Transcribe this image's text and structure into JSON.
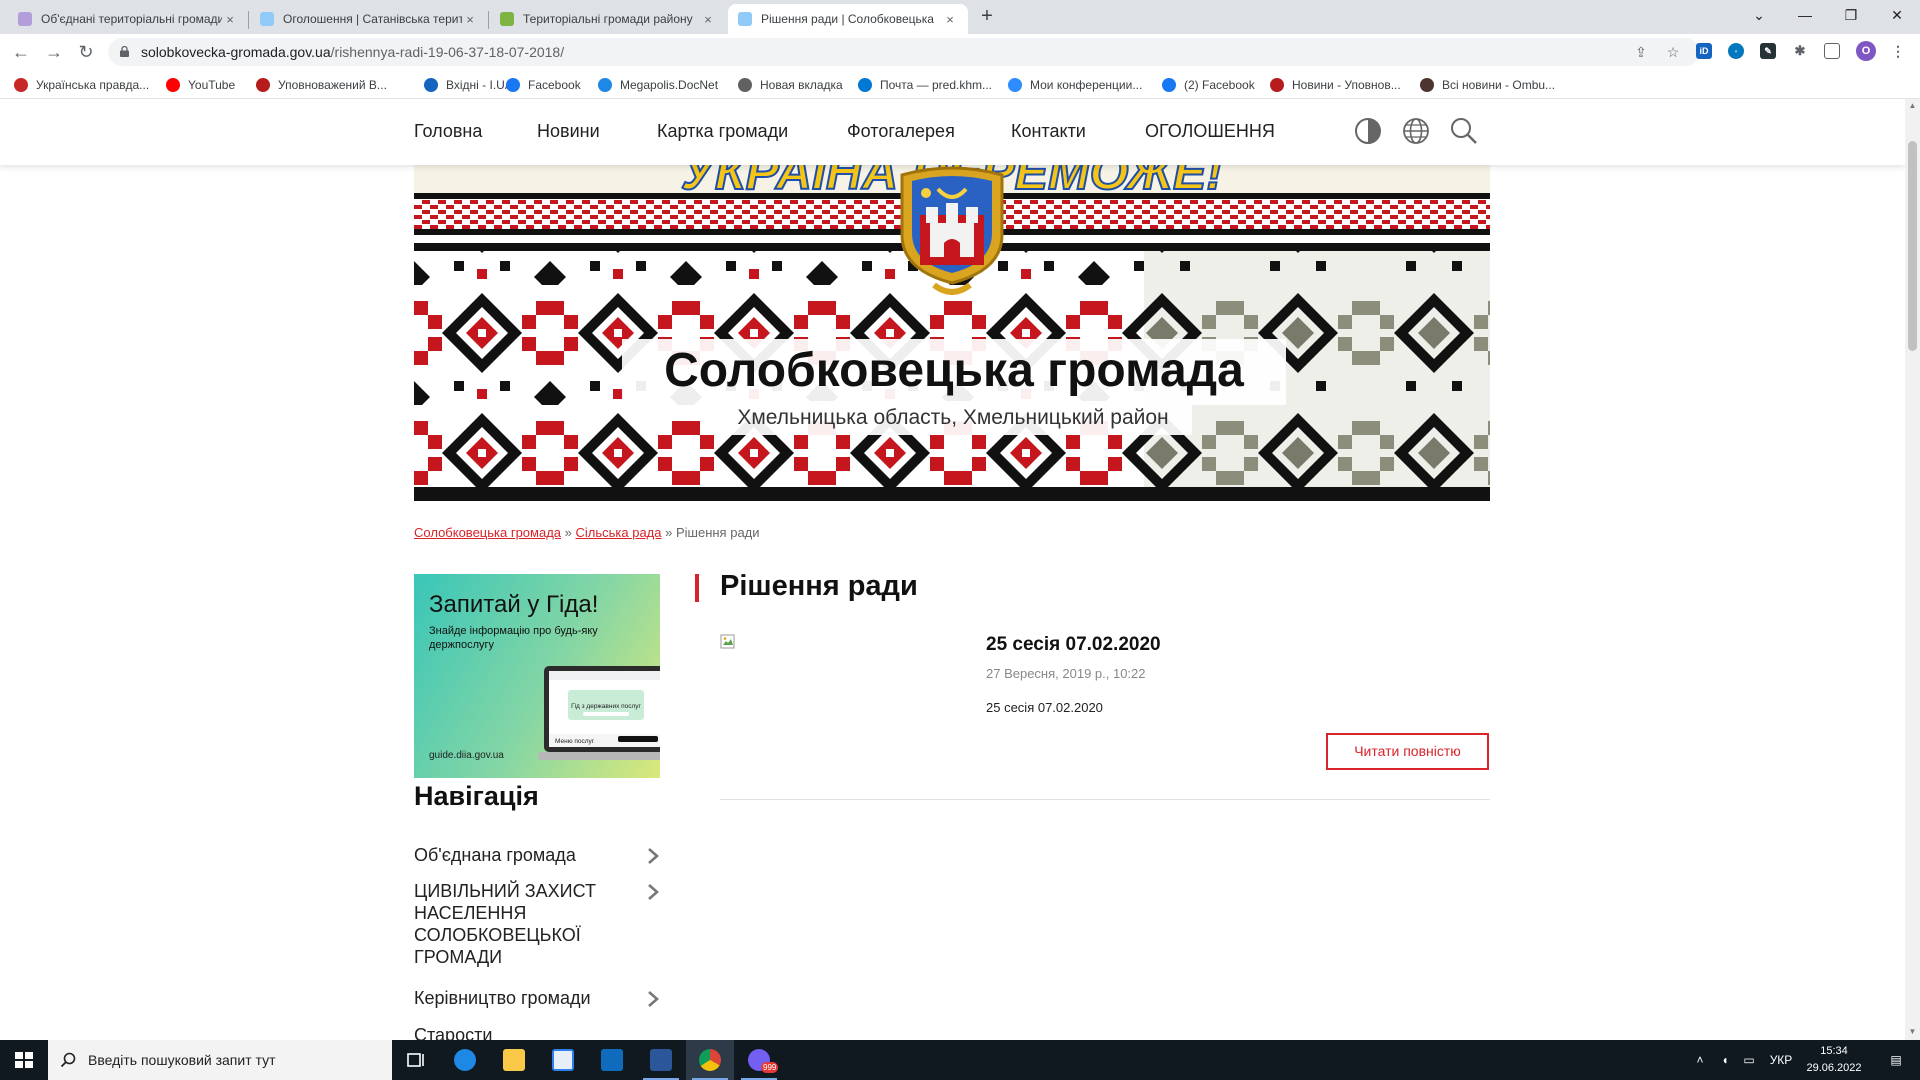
{
  "browser": {
    "tabs": [
      {
        "title": "Об'єднані територіальні громади",
        "active": false,
        "favicon_color": "#b39ddb"
      },
      {
        "title": "Оголошення | Сатанівська терит",
        "active": false,
        "favicon_color": "#90caf9"
      },
      {
        "title": "Територіальні громади району",
        "active": false,
        "favicon_color": "#7cb342"
      },
      {
        "title": "Рішення ради | Солобковецька",
        "active": true,
        "favicon_color": "#90caf9"
      }
    ],
    "tab_close_glyph": "×",
    "new_tab_glyph": "+",
    "url_host": "solobkovecka-gromada.gov.ua",
    "url_path": "/rishennya-radi-19-06-37-18-07-2018/",
    "profile_initial": "O",
    "bookmarks": [
      {
        "label": "Українська правда...",
        "icon": "up-icon",
        "color": "#c62828"
      },
      {
        "label": "YouTube",
        "icon": "youtube-icon",
        "color": "#ff0000"
      },
      {
        "label": "Уповноважений В...",
        "icon": "ombudsman-icon",
        "color": "#b71c1c"
      },
      {
        "label": "Вхідні - I.UA",
        "icon": "mail-icon",
        "color": "#1565c0"
      },
      {
        "label": "Facebook",
        "icon": "facebook-icon",
        "color": "#1877f2"
      },
      {
        "label": "Megapolis.DocNet",
        "icon": "docnet-icon",
        "color": "#1e88e5"
      },
      {
        "label": "Новая вкладка",
        "icon": "globe-icon",
        "color": "#616161"
      },
      {
        "label": "Почта — pred.khm...",
        "icon": "outlook-icon",
        "color": "#0078d4"
      },
      {
        "label": "Мои конференции...",
        "icon": "zoom-icon",
        "color": "#2d8cff"
      },
      {
        "label": "(2) Facebook",
        "icon": "facebook-icon",
        "color": "#1877f2"
      },
      {
        "label": "Новини - Уповнов...",
        "icon": "ombudsman-icon",
        "color": "#b71c1c"
      },
      {
        "label": "Всі новини - Ombu...",
        "icon": "ombudsman-icon",
        "color": "#4e342e"
      }
    ]
  },
  "site": {
    "nav": [
      "Головна",
      "Новини",
      "Картка громади",
      "Фотогалерея",
      "Контакти",
      "ОГОЛОШЕННЯ"
    ],
    "hero_slogan": "УКРАЇНА ПЕРЕМОЖЕ!",
    "title": "Солобковецька громада",
    "subtitle": "Хмельницька область, Хмельницький район",
    "breadcrumb": {
      "items": [
        "Солобковецька громада",
        "Сільська рада"
      ],
      "separator": "»",
      "current": "Рішення ради"
    },
    "banner": {
      "title": "Запитай у Гіда!",
      "subtitle": "Знайде інформацію про будь-яку держпослугу",
      "screen_text": "Гід з державних послуг",
      "screen_button": "Меню послуг",
      "url": "guide.diia.gov.ua"
    },
    "sidebar": {
      "heading": "Навігація",
      "items": [
        "Об'єднана громада",
        "ЦИВІЛЬНИЙ ЗАХИСТ НАСЕЛЕННЯ СОЛОБКОВЕЦЬКОЇ ГРОМАДИ",
        "Керівництво громади",
        "Старости"
      ]
    },
    "content": {
      "title": "Рішення ради",
      "post": {
        "title": "25 сесія 07.02.2020",
        "date": "27 Вересня, 2019 р., 10:22",
        "excerpt": "25 сесія 07.02.2020",
        "read_more": "Читати повністю"
      }
    },
    "colors": {
      "accent": "#d8232a",
      "ornament_black": "#111111",
      "ornament_grey": "#7a7a6a"
    }
  },
  "taskbar": {
    "search_placeholder": "Введіть пошуковий запит тут",
    "viber_badge": "999",
    "language": "УКР",
    "time": "15:34",
    "date": "29.06.2022"
  }
}
